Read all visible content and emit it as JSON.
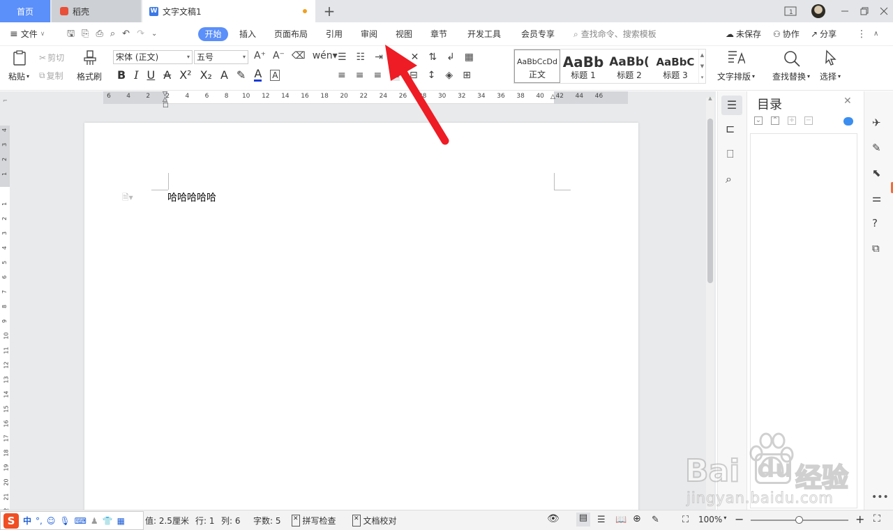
{
  "tabs": {
    "home": "首页",
    "daoke": "稻壳",
    "doc": "文字文稿1",
    "add": "+"
  },
  "menu": {
    "file": "文件",
    "items": [
      "开始",
      "插入",
      "页面布局",
      "引用",
      "审阅",
      "视图",
      "章节",
      "开发工具",
      "会员专享"
    ],
    "search_placeholder": "查找命令、搜索模板",
    "unsaved": "未保存",
    "collab": "协作",
    "share": "分享"
  },
  "ribbon": {
    "paste": "粘贴",
    "cut": "剪切",
    "copy": "复制",
    "format_painter": "格式刷",
    "font_name": "宋体 (正文)",
    "font_size": "五号",
    "bold": "B",
    "italic": "I",
    "underline": "U",
    "styles": [
      {
        "sample": "AaBbCcDd",
        "label": "正文"
      },
      {
        "sample": "AaBb",
        "label": "标题 1"
      },
      {
        "sample": "AaBb(",
        "label": "标题 2"
      },
      {
        "sample": "AaBbC",
        "label": "标题 3"
      }
    ],
    "text_layout": "文字排版",
    "find_replace": "查找替换",
    "select": "选择"
  },
  "ruler_h": [
    "6",
    "4",
    "2",
    "2",
    "4",
    "6",
    "8",
    "10",
    "12",
    "14",
    "16",
    "18",
    "20",
    "22",
    "24",
    "26",
    "28",
    "30",
    "32",
    "34",
    "36",
    "38",
    "40",
    "42",
    "44",
    "46"
  ],
  "ruler_v": [
    "4",
    "3",
    "2",
    "1",
    "1",
    "2",
    "3",
    "4",
    "5",
    "6",
    "7",
    "8",
    "9",
    "10",
    "11",
    "12",
    "13",
    "14",
    "15",
    "16",
    "17",
    "18",
    "19",
    "20",
    "21",
    "22"
  ],
  "document": {
    "text": "哈哈哈哈哈"
  },
  "toc": {
    "title": "目录"
  },
  "status": {
    "ime": "中",
    "setting": "值: 2.5厘米",
    "row": "行: 1",
    "col": "列: 6",
    "words": "字数: 5",
    "spell": "拼写检查",
    "proof": "文档校对",
    "zoom": "100%"
  },
  "watermark": {
    "brand": "Bai",
    "brand2": "经验",
    "url": "jingyan.baidu.com"
  },
  "colors": {
    "accent": "#5b8ff9",
    "arrow": "#ee1c24"
  }
}
